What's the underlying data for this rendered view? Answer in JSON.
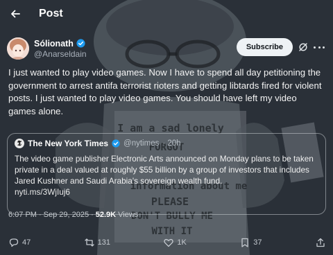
{
  "colors": {
    "background": "#2a3038",
    "verified_badge": "#1d9bf0",
    "text": "#f3f3f3",
    "muted": "#a8b0ba"
  },
  "header": {
    "title": "Post",
    "back_icon": "arrow-left-icon"
  },
  "author": {
    "name": "Sólionath",
    "handle": "@Anarseldain",
    "verified": true,
    "subscribe_label": "Subscribe"
  },
  "tweet": {
    "text": "I just wanted to play video games. Now I have to spend all day petitioning the government to arrest antifa terrorist rioters and getting libtards fired for violent posts. I just wanted to play video games. You should have left my video games alone."
  },
  "quote": {
    "name": "The New York Times",
    "handle": "@nytimes",
    "time": "· 20h",
    "verified": true,
    "text": "The video game publisher Electronic Arts announced on Monday plans to be taken private in a deal valued at roughly $55 billion by a group of investors that includes Jared Kushner and Saudi Arabia's sovereign wealth fund.",
    "link": "nyti.ms/3WjIuj6"
  },
  "meta": {
    "time": "6:07 PM",
    "date": "Sep 29, 2025",
    "views_count": "52.9K",
    "views_label": "Views"
  },
  "actions": {
    "replies": "47",
    "reposts": "131",
    "likes": "1K",
    "bookmarks": "37"
  },
  "background_meme": {
    "lines": [
      "I am a sad lonely",
      "FORGOT",
      "information about me",
      "PLEASE",
      "DON'T BULLY ME",
      "WITH IT"
    ]
  }
}
